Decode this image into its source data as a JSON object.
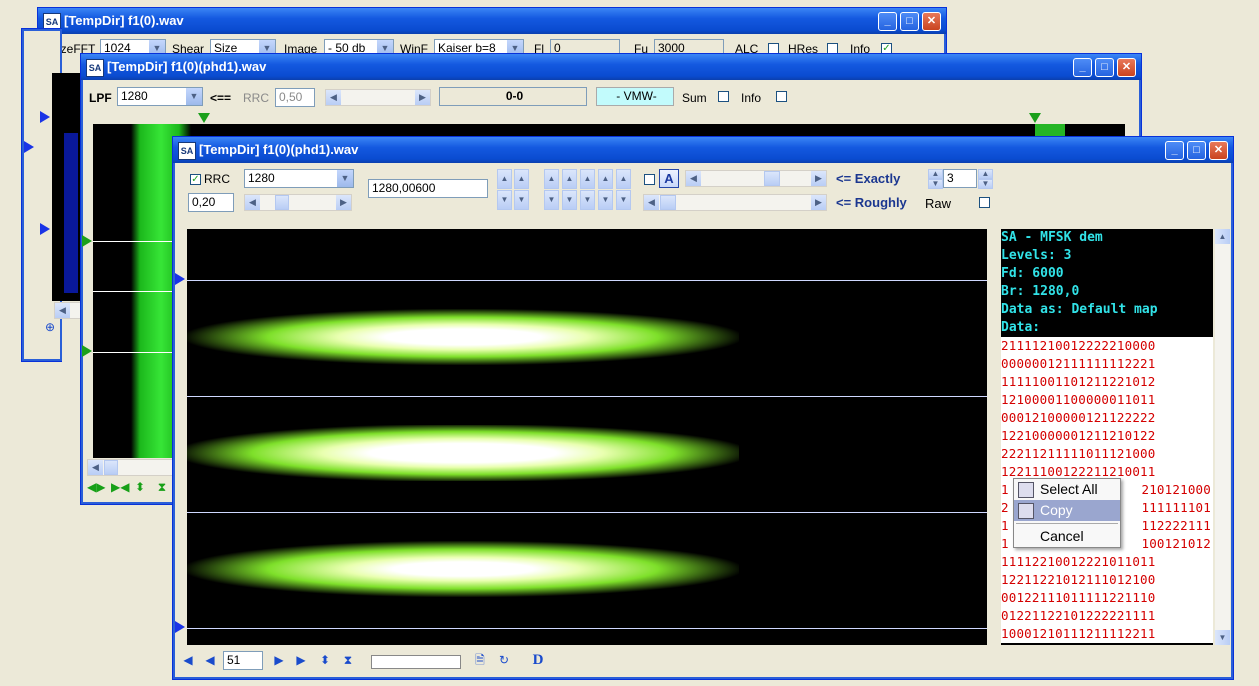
{
  "windows": {
    "back": {
      "title": "[TempDir] f1(0).wav",
      "size_fft_label": "SizeFFT",
      "size_fft_value": "1024",
      "shear_label": "Shear",
      "shear_value": "Size",
      "image_label": "Image",
      "image_value": "- 50 db",
      "winf_label": "WinF",
      "winf_value": "Kaiser b=8",
      "fl_label": "Fl",
      "fl_value": "0",
      "fu_label": "Fu",
      "fu_value": "3000",
      "alc_label": "ALC",
      "hres_label": "HRes",
      "info_label": "Info"
    },
    "middle": {
      "title": "[TempDir] f1(0)(phd1).wav",
      "lpf_label": "LPF",
      "lpf_value": "1280",
      "arrow_label": "<==",
      "rrc_label": "RRC",
      "rrc_value": "0,50",
      "range_value": "0-0",
      "vmw_label": "- VMW-",
      "sum_label": "Sum",
      "info_label": "Info"
    },
    "front": {
      "title": "[TempDir] f1(0)(phd1).wav",
      "rrc_label": "RRC",
      "rrc_select": "1280",
      "rolloff_value": "0,20",
      "rate_value": "1280,00600",
      "exactly_label": "<= Exactly",
      "roughly_label": "<= Roughly",
      "a_button": "A",
      "levels_value": "3",
      "raw_label": "Raw",
      "page_value": "51",
      "d_label": "D",
      "text_header": [
        "SA - MFSK dem",
        "Levels: 3",
        "Fd: 6000",
        "Br: 1280,0",
        "Data as: Default map",
        "Data:"
      ],
      "data_lines": [
        "21111210012222210000",
        "00000012111111112221",
        "11111001101211221012",
        "12100001100000011011",
        "00012100000121122222",
        "12210000001211210122",
        "22211211111011121000",
        "12211100122211210011",
        "1",
        "2",
        "1",
        "1",
        "11112210012221011011",
        "12211221012111012100",
        "00122111011111221110",
        "01221122101222221111",
        "10001210111211112211"
      ],
      "data_lines_right": [
        "",
        "",
        "",
        "",
        "",
        "",
        "",
        "",
        "210121000",
        "111111101",
        "112222111",
        "100121012",
        "",
        "",
        "",
        "",
        ""
      ]
    }
  },
  "context_menu": {
    "items": [
      "Select All",
      "Copy",
      "Cancel"
    ]
  }
}
